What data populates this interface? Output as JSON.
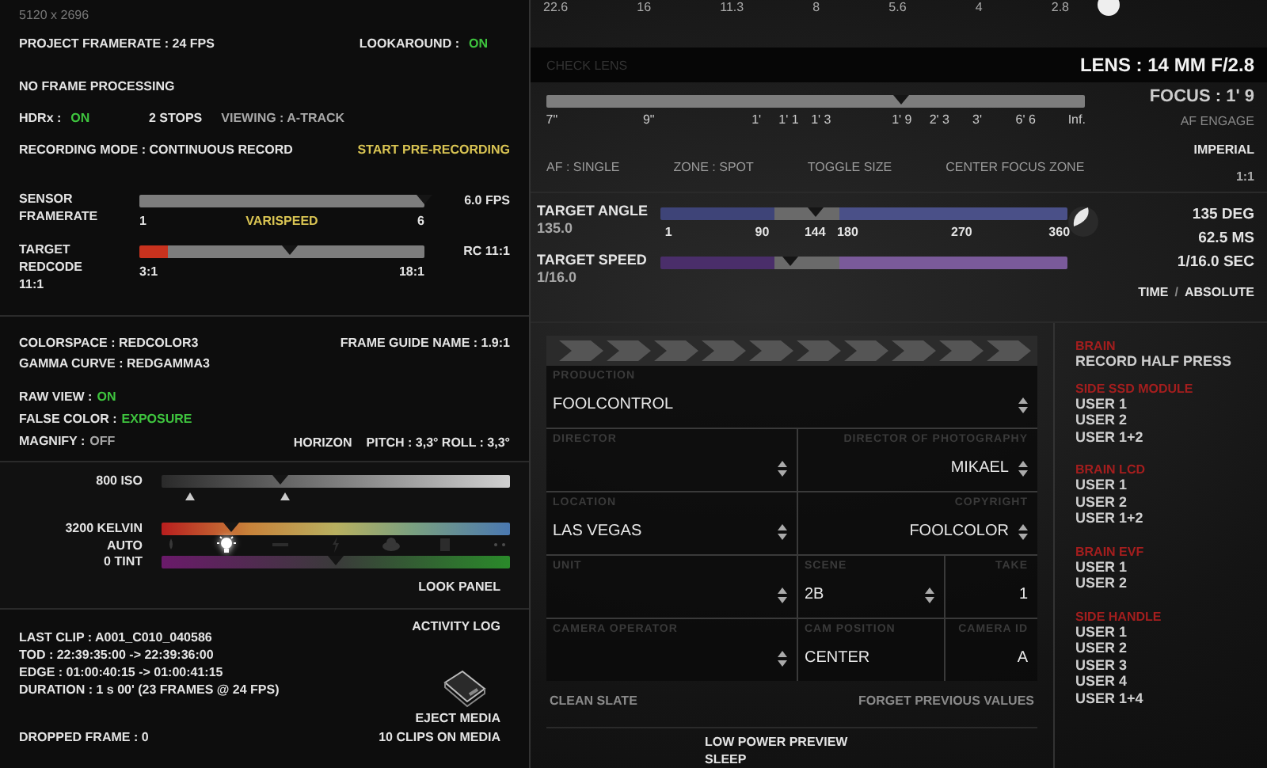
{
  "format": {
    "resolution": "5120 x 2696",
    "project_framerate": "PROJECT FRAMERATE : 24 FPS",
    "lookaround": {
      "label": "LOOKAROUND :",
      "value": "ON",
      "on": true
    },
    "frame_processing": "NO FRAME PROCESSING",
    "hdrx": {
      "label": "HDRx :",
      "value": "ON",
      "on": true
    },
    "hdrx_stops": "2 STOPS",
    "viewing": "VIEWING : A-TRACK",
    "recording_mode": "RECORDING MODE : CONTINUOUS RECORD",
    "pre_record_button": "START PRE-RECORDING"
  },
  "sliders": [
    {
      "kind": "grey",
      "label": "SENSOR FRAMERATE",
      "ticks": [
        "1",
        "6"
      ],
      "center_label": "VARISPEED",
      "reading": "6.0 FPS",
      "level": 1.0
    },
    {
      "kind": "redcode",
      "label": "TARGET REDCODE",
      "sublabel": "11:1",
      "ticks": [
        "3:1",
        "18:1"
      ],
      "reading": "RC 11:1",
      "level": 0.53
    }
  ],
  "look": {
    "colorspace": "COLORSPACE : REDCOLOR3",
    "gamma": "GAMMA CURVE  : REDGAMMA3",
    "frame_guide": "FRAME GUIDE NAME : 1.9:1",
    "raw_view": {
      "label": "RAW VIEW :",
      "value": "ON",
      "on": true
    },
    "false_color": {
      "label": "FALSE COLOR :",
      "value": "EXPOSURE",
      "on": true
    },
    "magnify": {
      "label": "MAGNIFY :",
      "value": "OFF",
      "on": false
    },
    "horizon": "HORIZON",
    "pitch_roll": "PITCH : 3,3° ROLL : 3,3°"
  },
  "color_sliders": [
    {
      "kind": "iso",
      "label": "800 ISO",
      "level": 0.34
    },
    {
      "kind": "kelvin",
      "label": "3200 KELVIN",
      "level": 0.2
    },
    {
      "kind": "tint",
      "label": "0 TINT",
      "level": 0.5
    }
  ],
  "white_balance": {
    "label": "AUTO",
    "presets": [
      {
        "kind": "candle",
        "selected": false
      },
      {
        "kind": "bulb",
        "selected": true
      },
      {
        "kind": "tube",
        "selected": false
      },
      {
        "kind": "flash",
        "selected": false
      },
      {
        "kind": "cloud",
        "selected": false
      },
      {
        "kind": "shade",
        "selected": false
      },
      {
        "kind": "more",
        "selected": false
      }
    ]
  },
  "look_panel_button": "LOOK PANEL",
  "clip": {
    "activity_log": "ACTIVITY LOG",
    "lines": [
      "LAST CLIP : A001_C010_040586",
      "TOD : 22:39:35:00 -> 22:39:36:00",
      "EDGE : 01:00:40:15 -> 01:00:41:15",
      "DURATION : 1 s 00' (23 FRAMES @ 24 FPS)"
    ],
    "eject": "EJECT MEDIA",
    "dropped": "DROPPED FRAME : 0",
    "clips_on_media": "10 CLIPS ON MEDIA"
  },
  "lens": {
    "apertures": [
      "22.6",
      "16",
      "11.3",
      "8",
      "5.6",
      "4",
      "2.8"
    ],
    "check_lens": "CHECK LENS",
    "lens": "LENS : 14 MM F/2.8",
    "focus_ticks": [
      "7\"",
      "9\"",
      "1'",
      "1' 1",
      "1' 3",
      "1' 9",
      "2' 3",
      "3'",
      "6' 6",
      "Inf."
    ],
    "level": 0.66,
    "focus": "FOCUS : 1' 9",
    "af_engage": "AF ENGAGE",
    "units": "IMPERIAL",
    "ratio": "1:1",
    "buttons": [
      "AF : SINGLE",
      "ZONE : SPOT",
      "TOGGLE SIZE",
      "CENTER FOCUS ZONE"
    ]
  },
  "shutter": {
    "angle": {
      "label": "TARGET ANGLE",
      "value": "135.0",
      "ticks": [
        "1",
        "90",
        "144",
        "180",
        "270",
        "360"
      ],
      "level": 0.38
    },
    "speed": {
      "label": "TARGET SPEED",
      "value": "1/16.0",
      "level": 0.32
    },
    "readings": [
      "135 DEG",
      "62.5 MS",
      "1/16.0 SEC"
    ],
    "mode": "TIME",
    "separator": "/",
    "mode_alt": "ABSOLUTE"
  },
  "slate": {
    "rows": [
      [
        {
          "label": "PRODUCTION",
          "value": "FOOLCONTROL",
          "stepper": true
        }
      ],
      [
        {
          "label": "DIRECTOR",
          "stepper": true
        },
        {
          "label": "DIRECTOR OF PHOTOGRAPHY",
          "value": "MIKAEL",
          "stepper": true
        }
      ],
      [
        {
          "label": "LOCATION",
          "value": "LAS VEGAS",
          "stepper": true
        },
        {
          "label": "COPYRIGHT",
          "value": "FOOLCOLOR",
          "stepper": true
        }
      ],
      [
        {
          "label": "UNIT",
          "stepper": true
        },
        {
          "label": "SCENE",
          "value": "2B",
          "stepper": true
        },
        {
          "label": "TAKE",
          "value": "1",
          "stepper": false
        }
      ],
      [
        {
          "label": "CAMERA OPERATOR",
          "stepper": true
        },
        {
          "label": "CAM POSITION",
          "value": "CENTER",
          "stepper": false
        },
        {
          "label": "CAMERA ID",
          "value": "A",
          "stepper": false
        }
      ]
    ],
    "clean_button": "CLEAN SLATE",
    "forget_button": "FORGET PREVIOUS VALUES"
  },
  "power": [
    "LOW POWER PREVIEW",
    "SLEEP"
  ],
  "button_map": [
    {
      "title": "BRAIN",
      "items": [
        "RECORD HALF PRESS"
      ]
    },
    {
      "title": "SIDE SSD MODULE",
      "items": [
        "USER 1",
        "USER 2",
        "USER 1+2"
      ]
    },
    {
      "title": "BRAIN LCD",
      "items": [
        "USER 1",
        "USER 2",
        "USER 1+2"
      ]
    },
    {
      "title": "BRAIN EVF",
      "items": [
        "USER 1",
        "USER 2"
      ]
    },
    {
      "title": "SIDE HANDLE",
      "items": [
        "USER 1",
        "USER 2",
        "USER 3",
        "USER 4",
        "USER 1+4"
      ]
    }
  ]
}
